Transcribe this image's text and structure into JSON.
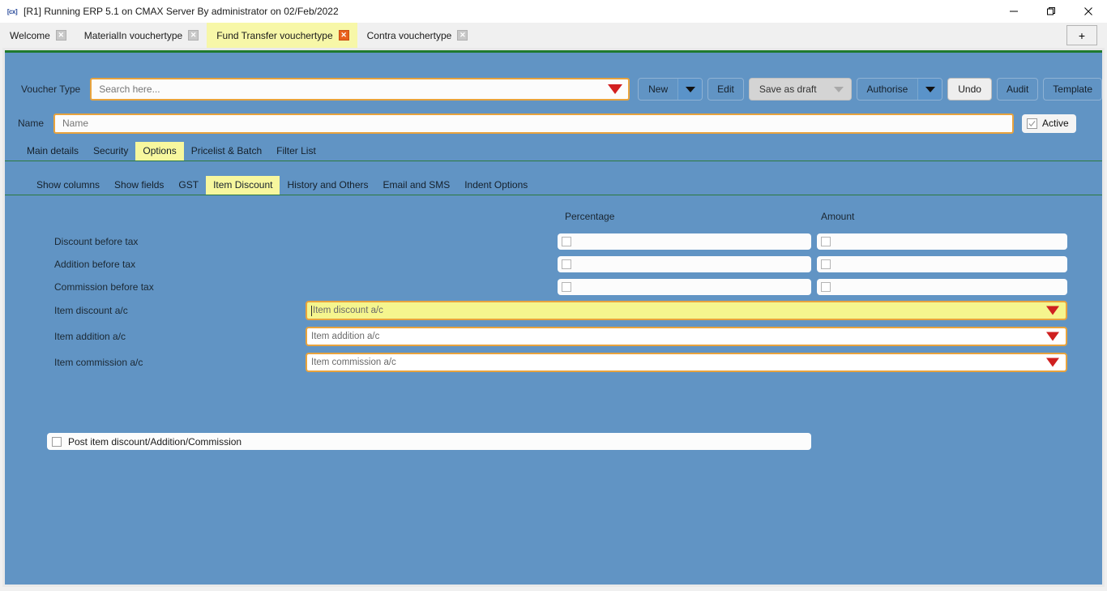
{
  "window": {
    "icon": "cx-logo-icon",
    "title": "[R1] Running ERP 5.1 on CMAX Server By administrator on 02/Feb/2022",
    "controls": {
      "minimize": "minimize-icon",
      "maximize": "maximize-icon",
      "close": "close-icon"
    }
  },
  "tabstrip": {
    "tabs": [
      {
        "label": "Welcome",
        "active": false
      },
      {
        "label": "MaterialIn vouchertype",
        "active": false
      },
      {
        "label": "Fund Transfer vouchertype",
        "active": true
      },
      {
        "label": "Contra vouchertype",
        "active": false
      }
    ],
    "new_tab_label": "+"
  },
  "voucher_row": {
    "label": "Voucher Type",
    "search_placeholder": "Search here...",
    "search_value": ""
  },
  "toolbar": {
    "new_label": "New",
    "edit_label": "Edit",
    "save_as_draft_label": "Save as draft",
    "authorise_label": "Authorise",
    "undo_label": "Undo",
    "audit_label": "Audit",
    "template_label": "Template"
  },
  "name_row": {
    "label": "Name",
    "placeholder": "Name",
    "value": "",
    "active_label": "Active",
    "active_checked": true
  },
  "primary_tabs": [
    {
      "label": "Main details",
      "selected": false
    },
    {
      "label": "Security",
      "selected": false
    },
    {
      "label": "Options",
      "selected": true
    },
    {
      "label": "Pricelist & Batch",
      "selected": false
    },
    {
      "label": "Filter List",
      "selected": false
    }
  ],
  "secondary_tabs": [
    {
      "label": "Show columns",
      "selected": false
    },
    {
      "label": "Show fields",
      "selected": false
    },
    {
      "label": "GST",
      "selected": false
    },
    {
      "label": "Item Discount",
      "selected": true
    },
    {
      "label": "History and Others",
      "selected": false
    },
    {
      "label": "Email and SMS",
      "selected": false
    },
    {
      "label": "Indent Options",
      "selected": false
    }
  ],
  "form": {
    "column_headers": {
      "percentage": "Percentage",
      "amount": "Amount"
    },
    "checkbox_rows": [
      {
        "label": "Discount before tax",
        "percentage_checked": false,
        "amount_checked": false
      },
      {
        "label": "Addition before tax",
        "percentage_checked": false,
        "amount_checked": false
      },
      {
        "label": "Commission before tax",
        "percentage_checked": false,
        "amount_checked": false
      }
    ],
    "dropdown_rows": [
      {
        "label": "Item discount a/c",
        "placeholder": "Item discount a/c",
        "value": "",
        "focused": true
      },
      {
        "label": "Item addition a/c",
        "placeholder": "Item addition a/c",
        "value": "",
        "focused": false
      },
      {
        "label": "Item commission a/c",
        "placeholder": "Item commission a/c",
        "value": "",
        "focused": false
      }
    ],
    "post_checkbox": {
      "label": "Post item discount/Addition/Commission",
      "checked": false
    }
  },
  "colors": {
    "content_background": "#6194c4",
    "accent_green": "#1f7a2e",
    "highlight_yellow": "#f7f79e",
    "field_border_orange": "#e8a33d",
    "caret_red": "#d32020",
    "active_tab_close_orange": "#e8601c"
  }
}
